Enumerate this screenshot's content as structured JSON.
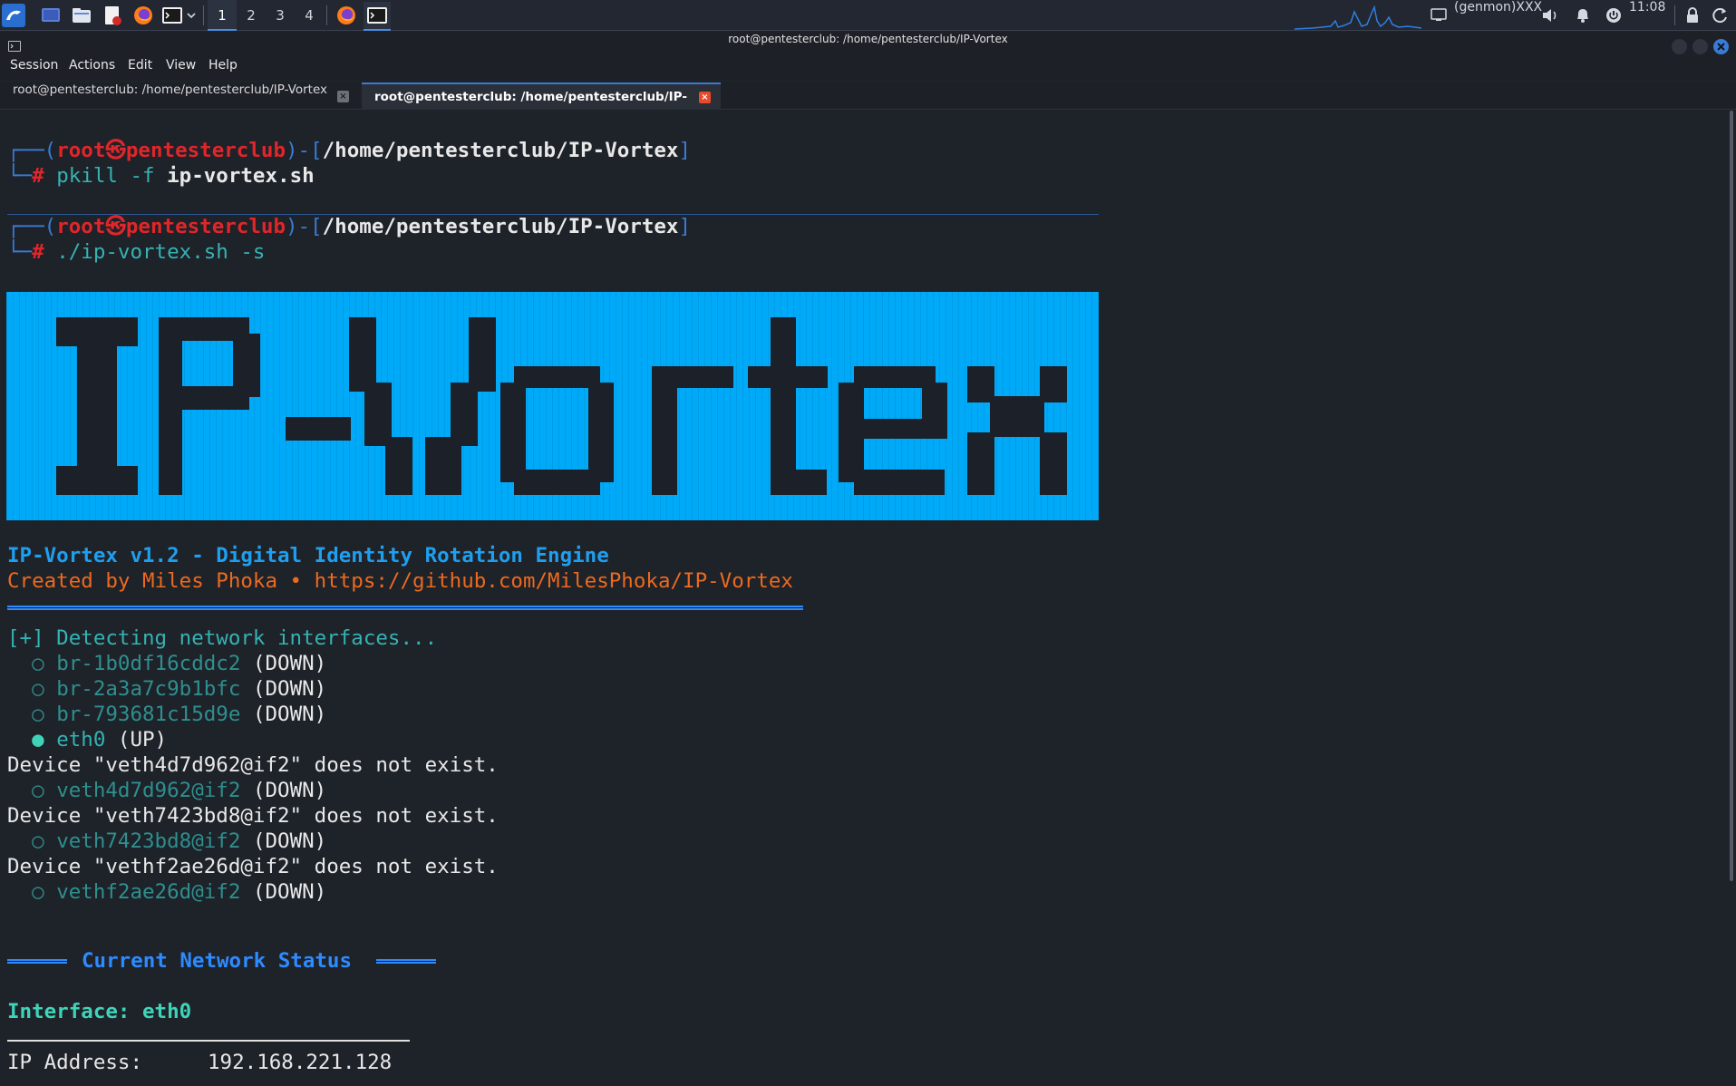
{
  "taskbar": {
    "workspaces": [
      "1",
      "2",
      "3",
      "4"
    ],
    "active_workspace": "1",
    "genmon": "(genmon)XXX",
    "clock": "11:08",
    "icons": [
      "kali-menu-icon",
      "desktop-icon",
      "file-manager-icon",
      "text-editor-icon",
      "firefox-icon",
      "terminal-icon",
      "chevron-down-icon",
      "firefox-icon",
      "terminal-icon",
      "display-icon",
      "volume-icon",
      "bell-icon",
      "power-icon",
      "lock-icon",
      "refresh-icon"
    ]
  },
  "window": {
    "title": "root@pentesterclub: /home/pentesterclub/IP-Vortex"
  },
  "menu": {
    "session": "Session",
    "actions": "Actions",
    "edit": "Edit",
    "view": "View",
    "help": "Help"
  },
  "tabs": [
    {
      "label": "root@pentesterclub: /home/pentesterclub/IP-Vortex",
      "active": false
    },
    {
      "label": "root@pentesterclub: /home/pentesterclub/IP-Vortex",
      "active": true
    }
  ],
  "terminal": {
    "prompt1": {
      "user": "root",
      "host": "pentesterclub",
      "path": "/home/pentesterclub/IP-Vortex",
      "cmd_prefix": "pkill -f ",
      "cmd_bold": "ip-vortex.sh"
    },
    "prompt2": {
      "user": "root",
      "host": "pentesterclub",
      "path": "/home/pentesterclub/IP-Vortex",
      "cmd": "./ip-vortex.sh -s"
    },
    "banner_text": "IP-Vortex",
    "version_line": "IP-Vortex v1.2 - Digital Identity Rotation Engine",
    "credit_line": "Created by Miles Phoka • https://github.com/MilesPhoka/IP-Vortex",
    "detecting": "[+] Detecting network interfaces...",
    "interfaces": [
      {
        "type": "iface",
        "bullet": "○",
        "name": "br-1b0df16cddc2",
        "state": "(DOWN)"
      },
      {
        "type": "iface",
        "bullet": "○",
        "name": "br-2a3a7c9b1bfc",
        "state": "(DOWN)"
      },
      {
        "type": "iface",
        "bullet": "○",
        "name": "br-793681c15d9e",
        "state": "(DOWN)"
      },
      {
        "type": "iface",
        "bullet": "●",
        "name": "eth0",
        "state": "(UP)"
      },
      {
        "type": "error",
        "text": "Device \"veth4d7d962@if2\" does not exist."
      },
      {
        "type": "iface",
        "bullet": "○",
        "name": "veth4d7d962@if2",
        "state": "(DOWN)"
      },
      {
        "type": "error",
        "text": "Device \"veth7423bd8@if2\" does not exist."
      },
      {
        "type": "iface",
        "bullet": "○",
        "name": "veth7423bd8@if2",
        "state": "(DOWN)"
      },
      {
        "type": "error",
        "text": "Device \"vethf2ae26d@if2\" does not exist."
      },
      {
        "type": "iface",
        "bullet": "○",
        "name": "vethf2ae26d@if2",
        "state": "(DOWN)"
      }
    ],
    "status_header": "Current Network Status",
    "interface_line": "Interface: eth0",
    "ip_label": "IP Address:",
    "ip_value": "192.168.221.128"
  }
}
